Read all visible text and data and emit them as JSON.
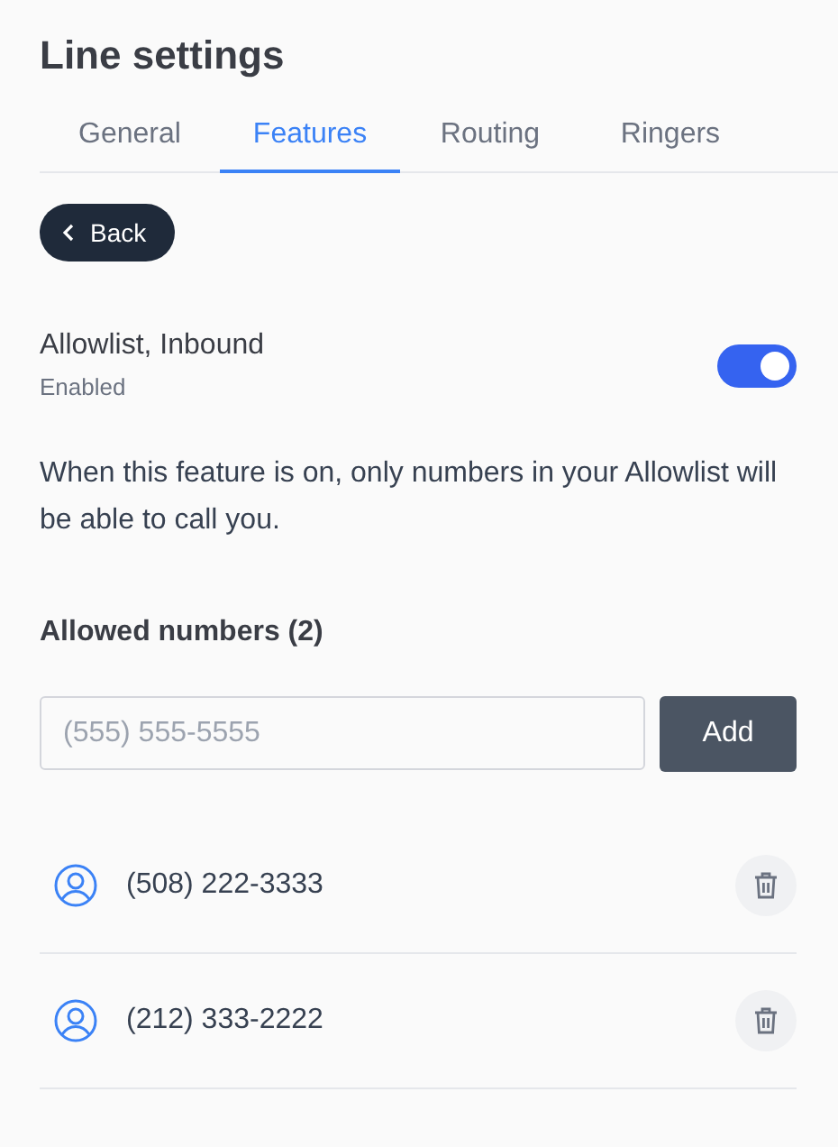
{
  "title": "Line settings",
  "tabs": [
    {
      "label": "General",
      "selected": false
    },
    {
      "label": "Features",
      "selected": true
    },
    {
      "label": "Routing",
      "selected": false
    },
    {
      "label": "Ringers",
      "selected": false
    }
  ],
  "back_button": "Back",
  "feature": {
    "name": "Allowlist, Inbound",
    "status": "Enabled",
    "on": true
  },
  "description": "When this feature is on, only numbers in your Allowlist will be able to call you.",
  "allowed_heading": "Allowed numbers (2)",
  "phone_input": {
    "placeholder": "(555) 555-5555"
  },
  "add_button": "Add",
  "numbers": [
    {
      "number": "(508) 222-3333"
    },
    {
      "number": "(212) 333-2222"
    }
  ]
}
